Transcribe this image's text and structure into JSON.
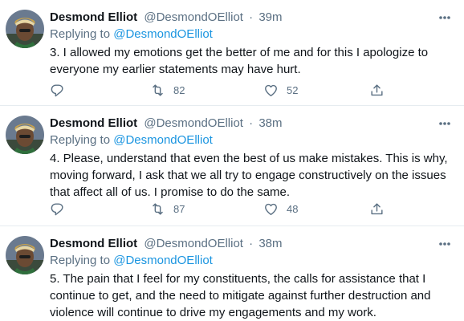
{
  "author": {
    "name": "Desmond Elliot",
    "handle": "@DesmondOElliot"
  },
  "tweets": [
    {
      "time": "39m",
      "replying_to_prefix": "Replying to",
      "replying_to": "@DesmondOElliot",
      "text": "3. I allowed my emotions get the better of me and for this I apologize to everyone my earlier statements may have hurt.",
      "retweets": "82",
      "likes": "52"
    },
    {
      "time": "38m",
      "replying_to_prefix": "Replying to",
      "replying_to": "@DesmondOElliot",
      "text": "4. Please, understand that even the best of us make mistakes. This is why, moving forward, I ask that we all try to engage constructively on the issues that affect all of us. I promise to do the same.",
      "retweets": "87",
      "likes": "48"
    },
    {
      "time": "38m",
      "replying_to_prefix": "Replying to",
      "replying_to": "@DesmondOElliot",
      "text": "5. The pain that I feel for my constituents, the calls for assistance that I continue to get, and the need to mitigate against further destruction and violence will continue to drive my engagements and my work."
    }
  ],
  "separator": "·",
  "icons": {
    "more": "more-horizontal-icon",
    "reply": "reply-icon",
    "retweet": "retweet-icon",
    "like": "heart-icon",
    "share": "share-icon"
  },
  "colors": {
    "text": "#0f1419",
    "secondary": "#5b7083",
    "mention": "#1b95e0",
    "divider": "#e6ecf0"
  }
}
